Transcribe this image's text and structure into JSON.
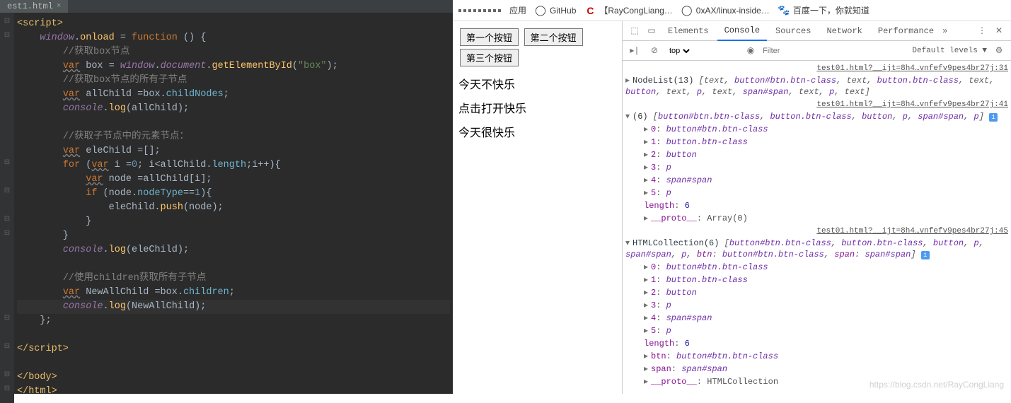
{
  "editor": {
    "tab_name": "est1.html",
    "tab_close": "×",
    "code_lines": [
      "<script>",
      "    window.onload = function () {",
      "        //获取box节点",
      "        var box = window.document.getElementById(\"box\");",
      "        //获取box节点的所有子节点",
      "        var allChild =box.childNodes;",
      "        console.log(allChild);",
      "",
      "        //获取子节点中的元素节点：",
      "        var eleChild =[];",
      "        for (var i =0; i<allChild.length;i++){",
      "            var node =allChild[i];",
      "            if (node.nodeType==1){",
      "                eleChild.push(node);",
      "            }",
      "        }",
      "        console.log(eleChild);",
      "",
      "        //使用children获取所有子节点",
      "        var NewAllChild =box.children;",
      "        console.log(NewAllChild);",
      "    };",
      "",
      "</script>",
      "",
      "</body>",
      "</html>"
    ]
  },
  "bookmarks": {
    "apps": "应用",
    "github": "GitHub",
    "ray": "【RayCongLiang…",
    "linux": "0xAX/linux-inside…",
    "baidu": "百度一下，你就知道"
  },
  "page": {
    "btn1": "第一个按钮",
    "btn2": "第二个按钮",
    "btn3": "第三个按钮",
    "p1": "今天不快乐",
    "p2": "点击打开快乐",
    "p3": "今天很快乐"
  },
  "devtools": {
    "tabs": {
      "elements": "Elements",
      "console": "Console",
      "sources": "Sources",
      "network": "Network",
      "performance": "Performance"
    },
    "toolbar": {
      "context": "top",
      "filter_ph": "Filter",
      "levels": "Default levels ▼"
    },
    "src1": "test01.html?__ijt=8h4…vnfefv9pes4br27j:31",
    "src2": "test01.html?__ijt=8h4…vnfefv9pes4br27j:41",
    "src3": "test01.html?__ijt=8h4…vnfefv9pes4br27j:45",
    "nodelist": "NodeList(13) [text, button#btn.btn-class, text, button.btn-class, text, button, text, p, text, span#span, text, p, text]",
    "arr6": "(6) [button#btn.btn-class, button.btn-class, button, p, span#span, p]",
    "items": [
      {
        "k": "0",
        "v": "button#btn.btn-class"
      },
      {
        "k": "1",
        "v": "button.btn-class"
      },
      {
        "k": "2",
        "v": "button"
      },
      {
        "k": "3",
        "v": "p"
      },
      {
        "k": "4",
        "v": "span#span"
      },
      {
        "k": "5",
        "v": "p"
      }
    ],
    "length": "length: 6",
    "proto_arr": "__proto__: Array(0)",
    "htmlcoll": "HTMLCollection(6) [button#btn.btn-class, button.btn-class, button, p, span#span, p, btn: button#btn.btn-class, span: span#span]",
    "btn_named": "btn: button#btn.btn-class",
    "span_named": "span: span#span",
    "proto_hc": "__proto__: HTMLCollection"
  },
  "watermark": "https://blog.csdn.net/RayCongLiang"
}
